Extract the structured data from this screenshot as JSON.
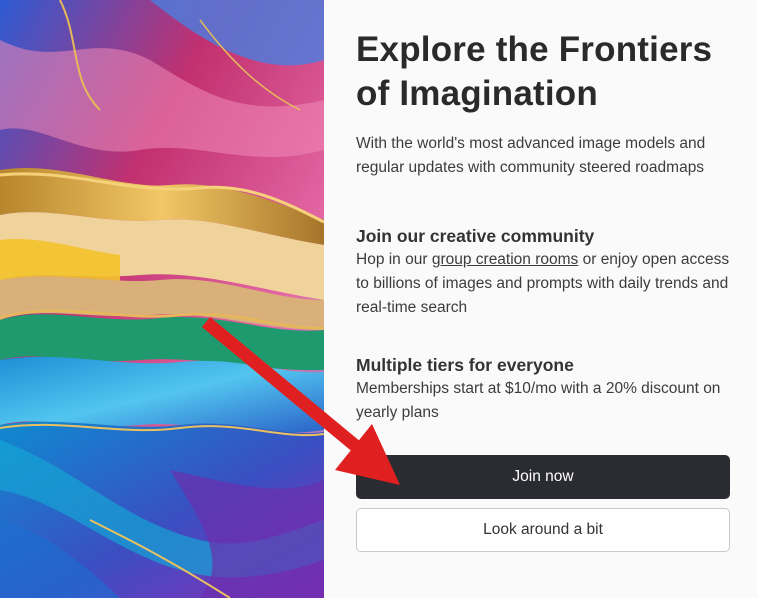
{
  "hero": {
    "title": "Explore the Frontiers of Imagination",
    "intro": "With the world's most advanced image models and regular updates with community steered roadmaps"
  },
  "sections": [
    {
      "heading": "Join our creative community",
      "body_before": "Hop in our ",
      "link_label": "group creation rooms",
      "body_after": " or enjoy open access to billions of images and prompts with daily trends and real-time search"
    },
    {
      "heading": "Multiple tiers for everyone",
      "body": "Memberships start at $10/mo with a 20% discount on yearly plans"
    }
  ],
  "actions": {
    "primary_label": "Join now",
    "secondary_label": "Look around a bit"
  },
  "colors": {
    "primary_button": "#2b2c31",
    "annotation_arrow": "#e02020"
  }
}
